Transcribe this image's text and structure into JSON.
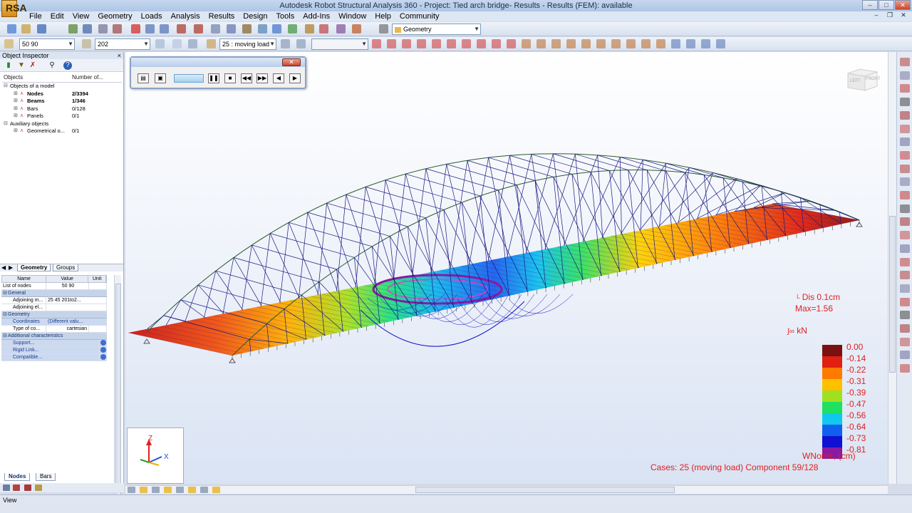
{
  "window": {
    "title": "Autodesk Robot Structural Analysis 360 - Project: Tied arch bridge- Results - Results (FEM): available",
    "app_logo": "RSA"
  },
  "menu": [
    "File",
    "Edit",
    "View",
    "Geometry",
    "Loads",
    "Analysis",
    "Results",
    "Design",
    "Tools",
    "Add-Ins",
    "Window",
    "Help",
    "Community"
  ],
  "toolbar": {
    "layout_combo": "Geometry",
    "node_combo": "50 90",
    "bar_combo": "202",
    "case_combo": "25 : moving load",
    "extra_combo": ""
  },
  "object_inspector": {
    "title": "Object Inspector",
    "columns": [
      "Objects",
      "Number of..."
    ],
    "tree": [
      {
        "label": "Objects of a model",
        "count": "",
        "level": 0,
        "bold": false
      },
      {
        "label": "Nodes",
        "count": "2/3394",
        "level": 1,
        "bold": true
      },
      {
        "label": "Beams",
        "count": "1/346",
        "level": 1,
        "bold": true
      },
      {
        "label": "Bars",
        "count": "0/128",
        "level": 1,
        "bold": false
      },
      {
        "label": "Panels",
        "count": "0/1",
        "level": 1,
        "bold": false
      },
      {
        "label": "Auxiliary objects",
        "count": "",
        "level": 0,
        "bold": false
      },
      {
        "label": "Geometrical o...",
        "count": "0/1",
        "level": 1,
        "bold": false
      }
    ],
    "tabs": [
      "Geometry",
      "Groups"
    ],
    "bottom_tabs": [
      "Nodes",
      "Bars"
    ]
  },
  "properties": {
    "columns": [
      "Name",
      "Value",
      "Unit"
    ],
    "list_of_nodes_label": "List of nodes",
    "list_of_nodes_value": "50 90",
    "general": "General",
    "adjoining_m_label": "Adjoining m...",
    "adjoining_m_value": "25 45 201to2...",
    "adjoining_el_label": "Adjoining el...",
    "geometry": "Geometry",
    "coordinates_label": "Coordinates",
    "coordinates_value": "(Different valu...",
    "type_label": "Type of co...",
    "type_value": "cartesian",
    "additional": "Additional characteristics",
    "support": "Support...",
    "rigid_link": "Rigid Link...",
    "compatible": "Compatible..."
  },
  "viewcube": {
    "left": "LEFT",
    "front": "FRONT"
  },
  "legend": {
    "dis_label": "Dis  0.1cm",
    "max_label": "Max=1.56",
    "force_unit": "kN",
    "scale": [
      {
        "value": "0.00",
        "color": "#7a1010"
      },
      {
        "value": "-0.14",
        "color": "#e02010"
      },
      {
        "value": "-0.22",
        "color": "#ff7a00"
      },
      {
        "value": "-0.31",
        "color": "#ffc000"
      },
      {
        "value": "-0.39",
        "color": "#a0e020"
      },
      {
        "value": "-0.47",
        "color": "#20e060"
      },
      {
        "value": "-0.56",
        "color": "#10c8f0"
      },
      {
        "value": "-0.64",
        "color": "#1060f0"
      },
      {
        "value": "-0.73",
        "color": "#1010d0"
      },
      {
        "value": "-0.81",
        "color": "#8a1aa0"
      }
    ],
    "component_label": "WNorm., (cm)",
    "cases_label": "Cases: 25 (moving load) Component 59/128"
  },
  "axes": {
    "z": "Z",
    "x": "X"
  },
  "status": {
    "text": "View"
  }
}
